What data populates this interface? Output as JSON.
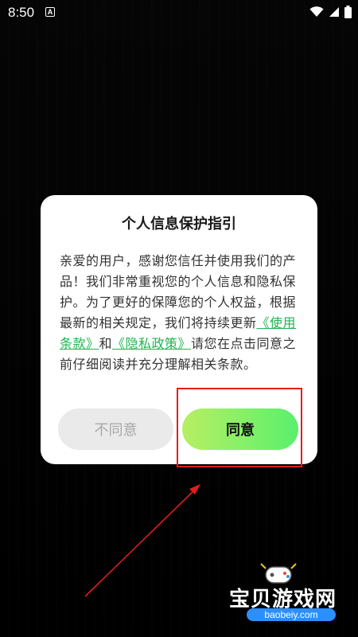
{
  "status_bar": {
    "time": "8:50",
    "badge": "A"
  },
  "dialog": {
    "title": "个人信息保护指引",
    "body_before": "亲爱的用户，感谢您信任并使用我们的产品！我们非常重视您的个人信息和隐私保护。为了更好的保障您的个人权益，根据最新的相关规定，我们将持续更新",
    "link_terms": "《使用条款》",
    "body_between": "和",
    "link_privacy": "《隐私政策》",
    "body_after": "请您在点击同意之前仔细阅读并充分理解相关条款。",
    "button_disagree": "不同意",
    "button_agree": "同意"
  },
  "watermark": {
    "title": "宝贝游戏网",
    "subtitle": "baobeiy.com"
  },
  "colors": {
    "background": "#000000",
    "link": "#22b34f",
    "agree_gradient_start": "#b8ef63",
    "agree_gradient_end": "#59f06c",
    "annotation_red": "#e11d1d"
  },
  "icons": {
    "wifi": "wifi-icon",
    "signal": "signal-icon",
    "battery": "battery-icon"
  }
}
